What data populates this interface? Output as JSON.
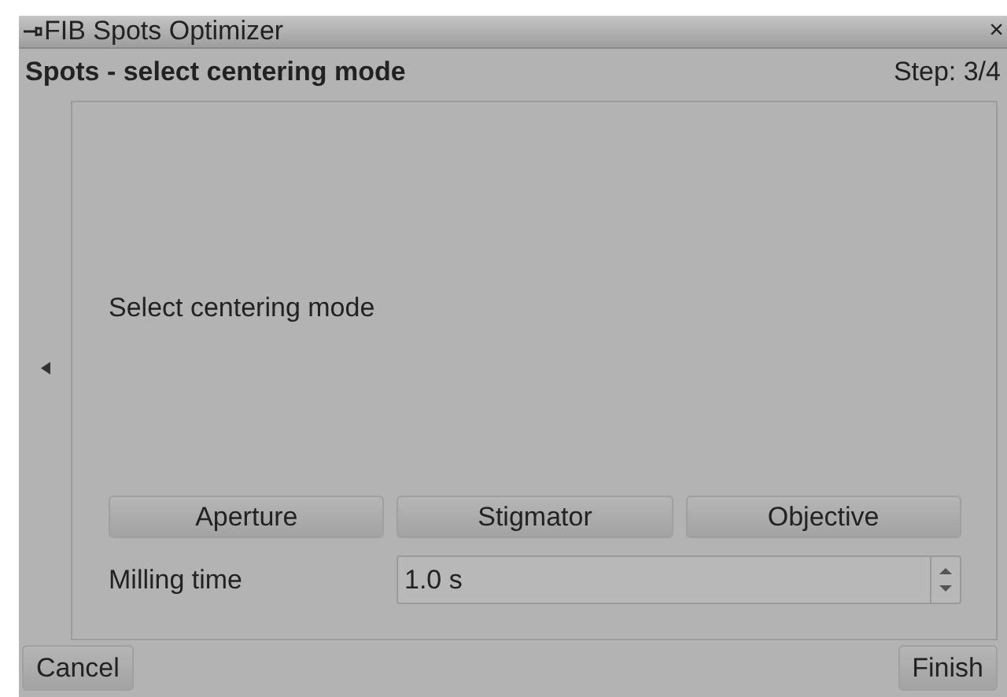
{
  "window": {
    "title": "FIB Spots Optimizer",
    "close": "×"
  },
  "header": {
    "title": "Spots - select centering mode",
    "step": "Step: 3/4"
  },
  "content": {
    "prompt": "Select centering mode",
    "modes": [
      "Aperture",
      "Stigmator",
      "Objective"
    ],
    "milling_time": {
      "label": "Milling time",
      "value": "1.0 s"
    }
  },
  "buttons": {
    "cancel": "Cancel",
    "finish": "Finish"
  }
}
